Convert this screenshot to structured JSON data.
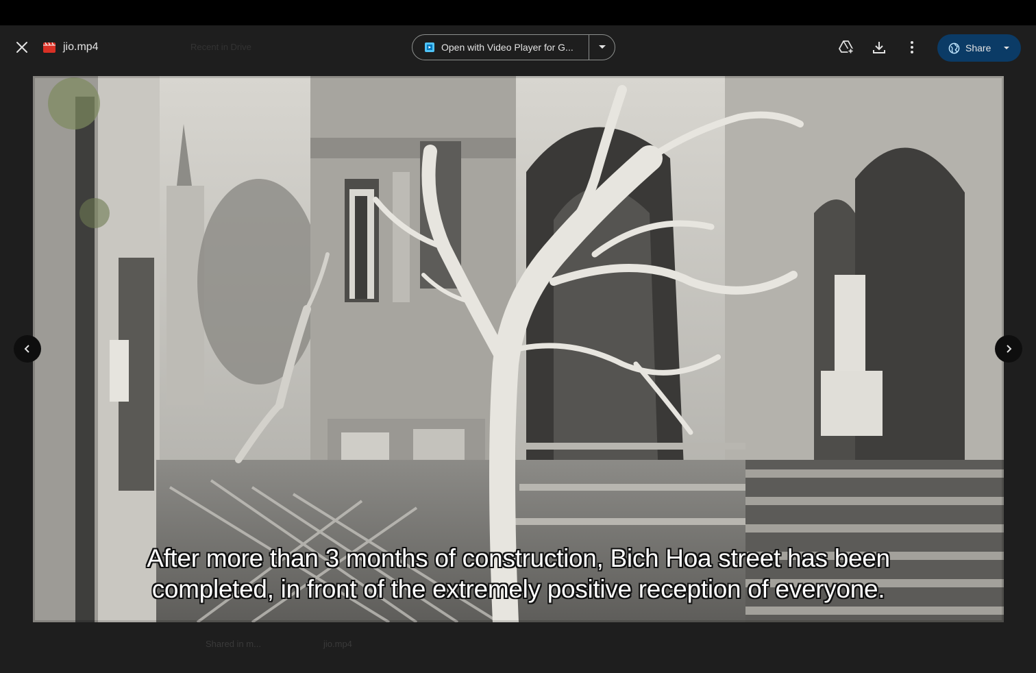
{
  "toolbar": {
    "file_name": "jio.mp4",
    "background_title_ghost": "Recent in Drive",
    "open_with_label": "Open with Video Player for G...",
    "share_label": "Share"
  },
  "icons": {
    "close": "close-icon",
    "file": "video-file-icon",
    "open_with_app": "video-player-app-icon",
    "open_with_dropdown": "chevron-down-icon",
    "add_to_drive": "add-to-drive-icon",
    "download": "download-icon",
    "more": "more-vert-icon",
    "share_globe": "globe-icon",
    "share_caret": "caret-down-icon",
    "prev": "chevron-left-icon",
    "next": "chevron-right-icon"
  },
  "video": {
    "subtitle_line1": "After more than 3 months of construction, Bich Hoa street has been",
    "subtitle_line2": "completed, in front of the extremely positive reception of everyone."
  },
  "background_ghost": {
    "shared_label": "Shared in m...",
    "file_label": "jio.mp4"
  },
  "colors": {
    "toolbar_bg": "#1e1e1e",
    "share_bg": "#0b3b66",
    "file_icon_red": "#d93025",
    "app_icon_blue": "#4fc3f7"
  }
}
